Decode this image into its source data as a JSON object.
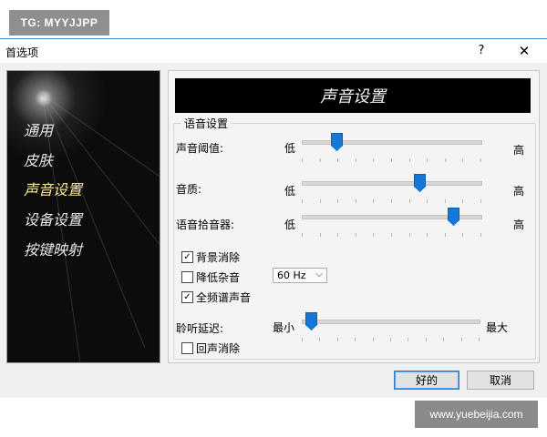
{
  "watermarks": {
    "top": "TG: MYYJJPP",
    "bottom": "www.yuebeijia.com"
  },
  "window": {
    "title": "首选项",
    "help": "?",
    "close": "✕"
  },
  "nav": {
    "items": [
      {
        "label": "通用"
      },
      {
        "label": "皮肤"
      },
      {
        "label": "声音设置",
        "active": true
      },
      {
        "label": "设备设置"
      },
      {
        "label": "按键映射"
      }
    ]
  },
  "banner": "声音设置",
  "group": {
    "title": "语音设置",
    "sliders": [
      {
        "label": "声音阈值:",
        "min": "低",
        "max": "高",
        "value": 0.17
      },
      {
        "label": "音质:",
        "min": "低",
        "max": "高",
        "value": 0.66
      },
      {
        "label": "语音拾音器:",
        "min": "低",
        "max": "高",
        "value": 0.86
      }
    ],
    "checkboxes": [
      {
        "label": "背景消除",
        "checked": true
      },
      {
        "label": "降低杂音",
        "checked": false
      },
      {
        "label": "全频谱声音",
        "checked": true
      }
    ],
    "noise_select": {
      "value": "60 Hz"
    },
    "latency": {
      "label": "聆听延迟:",
      "min": "最小",
      "max": "最大",
      "value": 0.02
    },
    "echo": {
      "label": "回声消除",
      "checked": false
    }
  },
  "buttons": {
    "ok": "好的",
    "cancel": "取消"
  },
  "colors": {
    "accent": "#1577d6",
    "panel_bg": "#0c0c0c",
    "active_nav": "#ffe79a"
  }
}
